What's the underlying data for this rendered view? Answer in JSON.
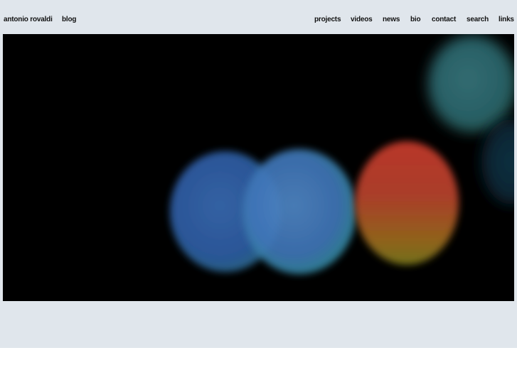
{
  "site": {
    "name_link": "antonio rovaldi",
    "blog_link": "blog"
  },
  "nav": {
    "items": [
      {
        "label": "projects"
      },
      {
        "label": "videos"
      },
      {
        "label": "news"
      },
      {
        "label": "bio"
      },
      {
        "label": "contact"
      },
      {
        "label": "search"
      },
      {
        "label": "links"
      }
    ]
  },
  "colors": {
    "background": "#e0e6ec",
    "image_background": "#000000",
    "text": "#111111"
  }
}
